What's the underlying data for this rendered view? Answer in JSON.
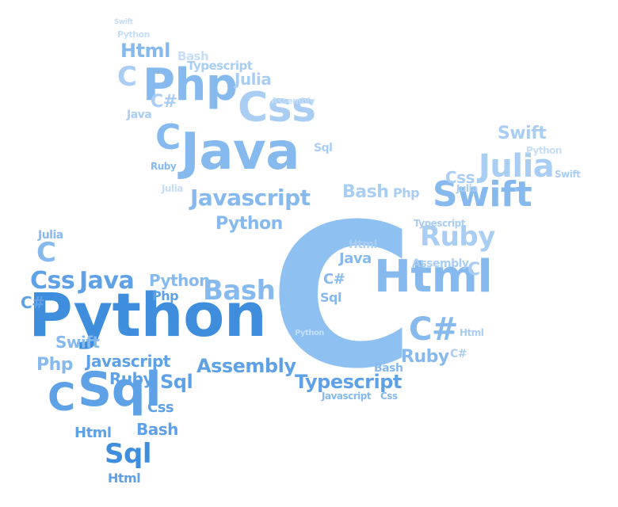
{
  "words": {
    "python_big": "Python",
    "c_big": "C",
    "java_big": "Java",
    "html_big": "Html",
    "php_big": "Php",
    "css_big": "Css",
    "sql_big": "Sql",
    "c_left": "C",
    "swift_r": "Swift",
    "julia_r": "Julia",
    "ruby_r": "Ruby",
    "javascript_m": "Javascript",
    "bash_m": "Bash",
    "assembly_m": "Assembly",
    "typescript_m": "Typescript",
    "csharp_m": "C#",
    "python_m": "Python",
    "html_top": "Html",
    "bash_top": "Bash",
    "python_top": "Python",
    "swift_top": "Swift",
    "julia_top": "Julia",
    "c_top": "C",
    "csharp_top": "C#",
    "typescript_top": "Typescript",
    "assembly_top": "Assembly",
    "css_l": "Css",
    "java_l": "Java",
    "python_l": "Python",
    "php_l": "Php",
    "swift_l": "Swift",
    "ruby_l": "Ruby",
    "javascript_l": "Javascript",
    "sql_l": "Sql",
    "bash_l": "Bash",
    "html_l": "Html",
    "css_l2": "Css",
    "sql_l2": "Sql",
    "html_l2": "Html",
    "julia_l": "Julia",
    "csharp_l": "C#",
    "c_l": "C",
    "java_s": "Java",
    "php_s": "Php",
    "csharp_s": "C#",
    "ruby_s": "Ruby",
    "julia_s": "Julia",
    "sql_s": "Sql",
    "css_s": "Css",
    "bash_s": "Bash",
    "html_s": "Html",
    "c_s": "C",
    "swift_s": "Swift",
    "typescript_s": "Typescript",
    "python_s": "Python",
    "java_r": "Java",
    "sql_r": "Sql",
    "ruby_r2": "Ruby",
    "c_r": "C",
    "csharp_r": "C#",
    "php_r": "Php",
    "html_r": "Html",
    "bash_r": "Bash",
    "swift_r2": "Swift",
    "python_r": "Python",
    "css_r": "Css",
    "julia_r2": "Julia",
    "assembly_r": "Assembly",
    "javascript_r": "Javascript"
  }
}
